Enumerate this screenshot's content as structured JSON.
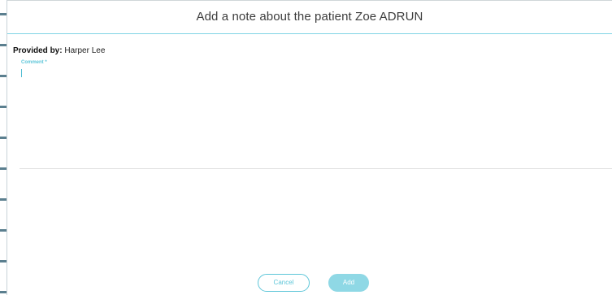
{
  "dialog": {
    "title": "Add a note about the patient Zoe ADRUN"
  },
  "provider": {
    "label": "Provided by:",
    "name": "Harper Lee"
  },
  "comment": {
    "label": "Comment *",
    "value": ""
  },
  "actions": {
    "cancel_label": "Cancel",
    "add_label": "Add"
  },
  "colors": {
    "accent": "#5ec6d9",
    "accent_disabled": "#8fd8e5",
    "header_rule": "#7fd4e4",
    "text": "#3c3c3c"
  }
}
